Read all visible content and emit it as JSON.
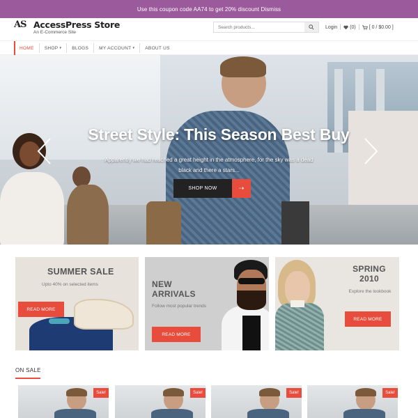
{
  "topbar": {
    "text": "Use this coupon code AA74 to get 20% discount Dismiss"
  },
  "header": {
    "logo_mark": "AS",
    "title": "AccessPress Store",
    "subtitle": "An E-Commerce Site",
    "search_placeholder": "Search products...",
    "login_label": "Login",
    "wishlist_label": "(0)",
    "cart_label": "[ 0 / $0.00 ]"
  },
  "nav": {
    "items": [
      "HOME",
      "SHOP",
      "BLOGS",
      "MY ACCOUNT",
      "ABOUT US"
    ],
    "active": "HOME"
  },
  "hero": {
    "title": "Street Style: This Season Best Buy",
    "description": "Apparently we had reached a great height in the atmosphere, for the sky was a dead black and there a stars...",
    "button_label": "SHOP NOW"
  },
  "promos": [
    {
      "title": "SUMMER SALE",
      "subtitle": "Upto 40% on selected items",
      "button": "READ MORE"
    },
    {
      "title": "NEW ARRIVALS",
      "subtitle": "Follow most popular trends",
      "button": "READ MORE"
    },
    {
      "title": "SPRING 2010",
      "subtitle": "Explore the lookbook",
      "button": "READ MORE"
    }
  ],
  "section": {
    "title": "ON SALE"
  },
  "products": [
    {
      "badge": "Sale!"
    },
    {
      "badge": "Sale!"
    },
    {
      "badge": "Sale!"
    },
    {
      "badge": "Sale!"
    }
  ],
  "colors": {
    "accent": "#e74c3c",
    "topbar": "#9b5a9b",
    "dark": "#222222"
  }
}
